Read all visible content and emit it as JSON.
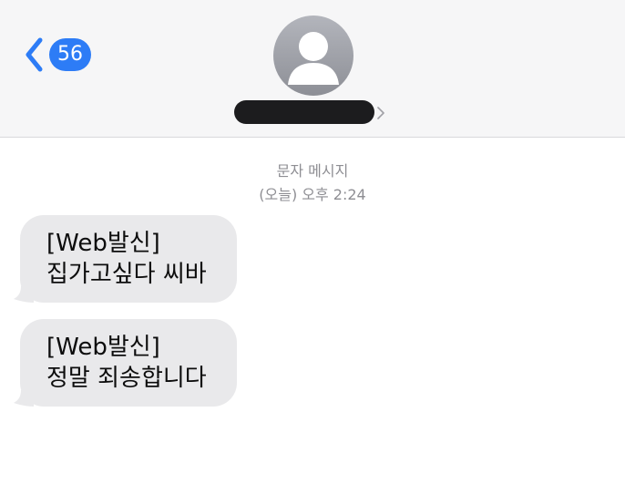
{
  "header": {
    "back_badge_count": "56",
    "contact_name": "",
    "colors": {
      "header_bg": "#f6f6f7",
      "accent": "#2d7cf6"
    }
  },
  "thread": {
    "message_type": "문자 메시지",
    "timestamp": "(오늘) 오후 2:24",
    "messages": [
      {
        "line1": "[Web발신]",
        "line2": "집가고싶다 씨바"
      },
      {
        "line1": "[Web발신]",
        "line2": "정말 죄송합니다"
      }
    ],
    "colors": {
      "incoming_bubble": "#e9e9eb",
      "meta_text": "#8e8e93"
    }
  },
  "icons": {
    "back": "chevron-left-icon",
    "avatar": "person-silhouette-icon",
    "contact_details": "chevron-right-icon"
  }
}
